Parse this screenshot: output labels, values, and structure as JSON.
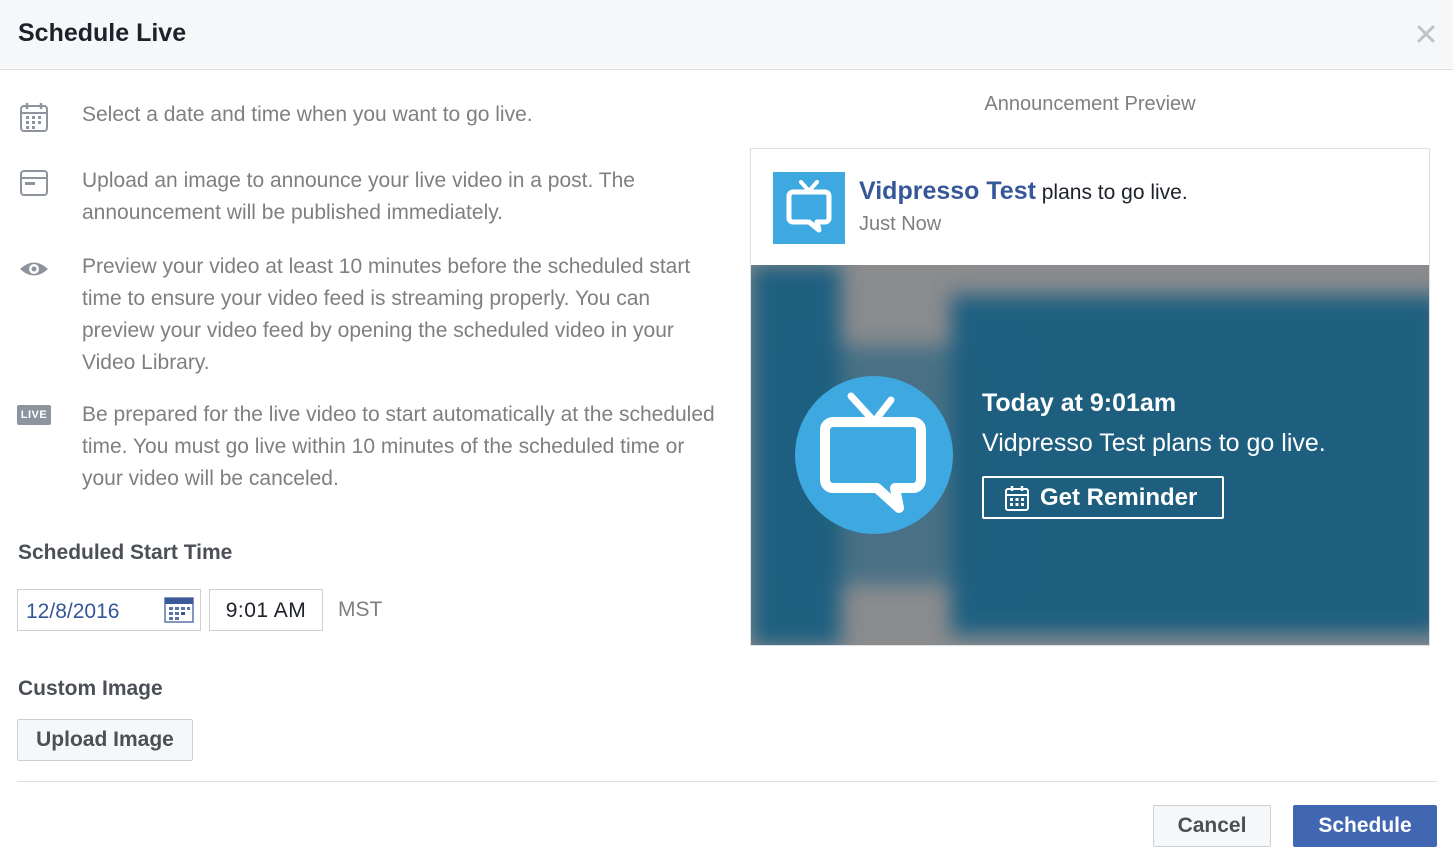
{
  "dialog": {
    "title": "Schedule Live",
    "close_icon": "close-icon"
  },
  "info": [
    {
      "icon": "calendar-icon",
      "text": "Select a date and time when you want to go live."
    },
    {
      "icon": "window-icon",
      "text": "Upload an image to announce your live video in a post. The announcement will be published immediately."
    },
    {
      "icon": "eye-icon",
      "text": "Preview your video at least 10 minutes before the scheduled start time to ensure your video feed is streaming properly. You can preview your video feed by opening the scheduled video in your Video Library."
    },
    {
      "icon": "live-badge-icon",
      "badge": "LIVE",
      "text": "Be prepared for the live video to start automatically at the scheduled time. You must go live within 10 minutes of the scheduled time or your video will be canceled."
    }
  ],
  "schedule": {
    "label": "Scheduled Start Time",
    "date": "12/8/2016",
    "time": "9:01 AM",
    "timezone": "MST"
  },
  "custom_image": {
    "label": "Custom Image",
    "upload_label": "Upload Image"
  },
  "preview": {
    "heading": "Announcement Preview",
    "page_name": "Vidpresso Test",
    "post_text": " plans to go live.",
    "post_time": "Just Now",
    "banner_when": "Today at 9:01am",
    "banner_message": "Vidpresso Test plans to go live.",
    "reminder_label": "Get Reminder"
  },
  "footer": {
    "cancel_label": "Cancel",
    "schedule_label": "Schedule"
  },
  "colors": {
    "accent": "#4267b2",
    "link": "#365899",
    "brand_blue": "#3ea8e0",
    "banner_blue": "#1e5f80"
  }
}
